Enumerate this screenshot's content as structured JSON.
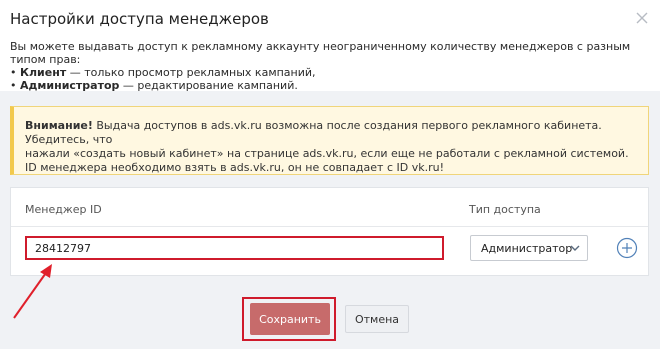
{
  "modal": {
    "title": "Настройки доступа менеджеров"
  },
  "intro": {
    "line1": "Вы можете выдавать доступ к рекламному аккаунту неограниченному количеству менеджеров с разным типом прав:",
    "client_label": "Клиент",
    "client_desc": " — только просмотр рекламных кампаний,",
    "admin_label": "Администратор",
    "admin_desc": " — редактирование кампаний."
  },
  "warning": {
    "label": "Внимание!",
    "text1": " Выдача доступов в ads.vk.ru возможна после создания первого рекламного кабинета. Убедитесь, что",
    "text2": "нажали «создать новый кабинет» на странице ads.vk.ru, если еще не работали с рекламной системой.",
    "text3": "ID менеджера необходимо взять в ads.vk.ru, он не совпадает с ID vk.ru!"
  },
  "table": {
    "col_manager": "Менеджер",
    "col_id": "ID",
    "col_access": "Тип доступа"
  },
  "manager_row": {
    "id_value": "28412797",
    "access_selected": "Администратор"
  },
  "buttons": {
    "save": "Сохранить",
    "cancel": "Отмена"
  },
  "colors": {
    "highlight_red": "#cf1b2c",
    "save_button": "#c76b6b",
    "accent_blue": "#5181b8",
    "warning_bg": "#fff8e1"
  },
  "icons": {
    "close": "close-icon",
    "dropdown": "chevron-down-icon",
    "add": "add-row-icon"
  }
}
